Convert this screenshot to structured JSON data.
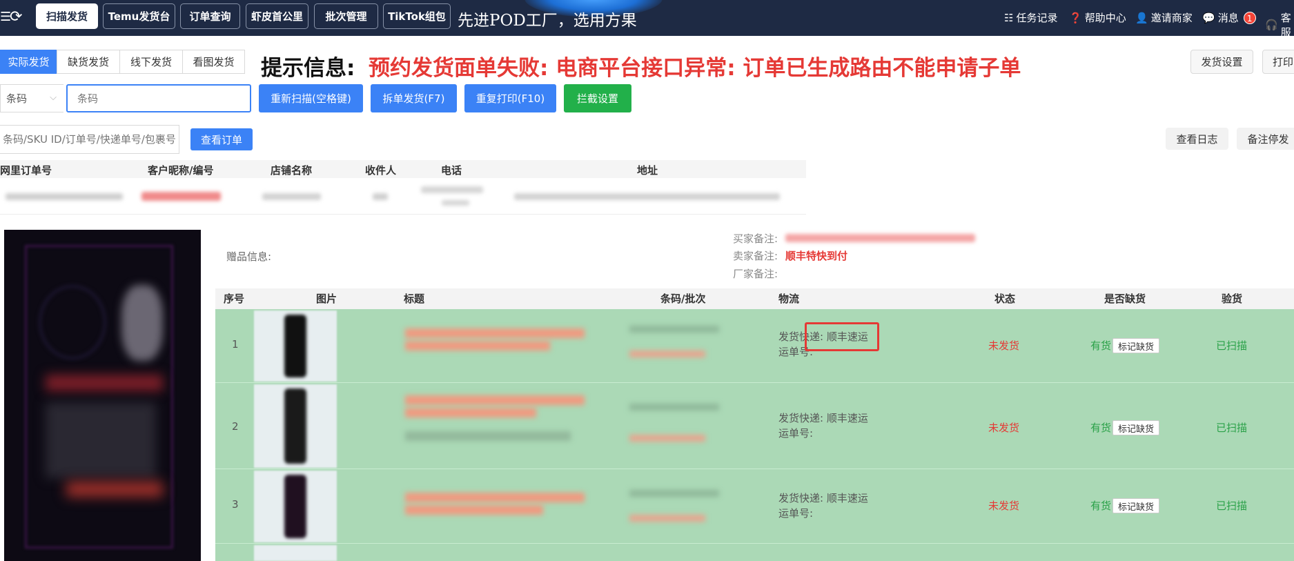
{
  "topbar": {
    "nav": [
      "扫描发货",
      "Temu发货台",
      "订单查询",
      "虾皮首公里",
      "批次管理",
      "TikTok组包"
    ],
    "slogan": "先进POD工厂，选用方果",
    "links": {
      "tasks": "任务记录",
      "help": "帮助中心",
      "invite": "邀请商家",
      "messages": "消息",
      "message_count": "1",
      "service": "客服"
    }
  },
  "mode_tabs": [
    "实际发货",
    "缺货发货",
    "线下发货",
    "看图发货"
  ],
  "notice": {
    "label": "提示信息:",
    "text": "预约发货面单失败: 电商平台接口异常: 订单已生成路由不能申请子单"
  },
  "top_right_buttons": {
    "ship_settings": "发货设置",
    "print": "打印"
  },
  "scan": {
    "select_value": "条码",
    "input_placeholder": "条码",
    "buttons": [
      "重新扫描(空格键)",
      "拆单发货(F7)",
      "重复打印(F10)",
      "拦截设置"
    ]
  },
  "search": {
    "placeholder": "条码/SKU ID/订单号/快递单号/包裹号",
    "view_order": "查看订单",
    "view_log": "查看日志",
    "remark_stop": "备注停发"
  },
  "order_table": {
    "headers": [
      "网里订单号",
      "客户昵称/编号",
      "店铺名称",
      "收件人",
      "电话",
      "地址"
    ]
  },
  "remarks": {
    "gift_label": "赠品信息:",
    "buyer_label": "买家备注:",
    "seller_label": "卖家备注:",
    "seller_value": "顺丰特快到付",
    "factory_label": "厂家备注:"
  },
  "items_table": {
    "headers": [
      "序号",
      "图片",
      "标题",
      "条码/批次",
      "物流",
      "状态",
      "是否缺货",
      "验货"
    ],
    "rows": [
      {
        "seq": "1",
        "logistics": "发货快递: 顺丰速运",
        "tracking": "运单号:",
        "status": "未发货",
        "stock": "有货",
        "mark": "标记缺货",
        "check": "已扫描"
      },
      {
        "seq": "2",
        "logistics": "发货快递: 顺丰速运",
        "tracking": "运单号:",
        "status": "未发货",
        "stock": "有货",
        "mark": "标记缺货",
        "check": "已扫描"
      },
      {
        "seq": "3",
        "logistics": "发货快递: 顺丰速运",
        "tracking": "运单号:",
        "status": "未发货",
        "stock": "有货",
        "mark": "标记缺货",
        "check": "已扫描"
      }
    ]
  },
  "colors": {
    "topbar": "#1e2a44",
    "primary": "#3b82f6",
    "success": "#22b04a",
    "danger": "#e53935",
    "row_bg": "#abd9b6"
  }
}
